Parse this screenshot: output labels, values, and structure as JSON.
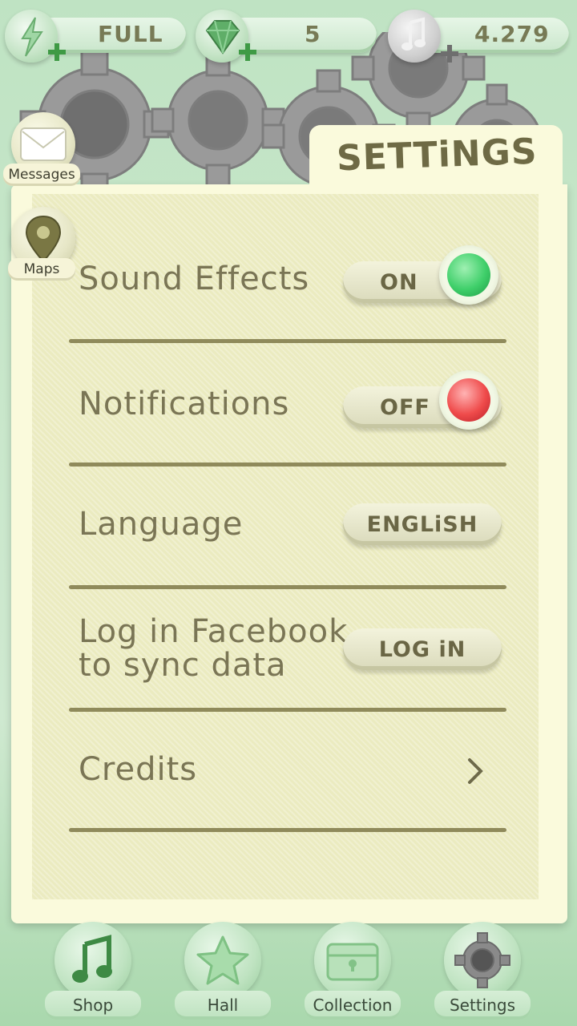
{
  "top_bar": {
    "energy": {
      "value": "FULL",
      "icon": "lightning-icon"
    },
    "gems": {
      "value": "5",
      "icon": "gem-icon"
    },
    "notes": {
      "value": "4.279",
      "icon": "music-note-icon"
    }
  },
  "side": {
    "messages_label": "Messages",
    "maps_label": "Maps"
  },
  "panel": {
    "title": "SETTiNGS",
    "rows": {
      "sound": {
        "label": "Sound Effects",
        "state": "ON"
      },
      "notifications": {
        "label": "Notifications",
        "state": "OFF"
      },
      "language": {
        "label": "Language",
        "value": "ENGLiSH"
      },
      "facebook": {
        "label_line1": "Log in Facebook",
        "label_line2": "to sync data",
        "button": "LOG iN"
      },
      "credits": {
        "label": "Credits"
      }
    }
  },
  "nav": {
    "shop": "Shop",
    "hall": "Hall",
    "collection": "Collection",
    "settings": "Settings"
  },
  "colors": {
    "on": "#3fcf6a",
    "off": "#ef4b4b",
    "panel": "#fafadc",
    "background": "#c9e7cb"
  }
}
